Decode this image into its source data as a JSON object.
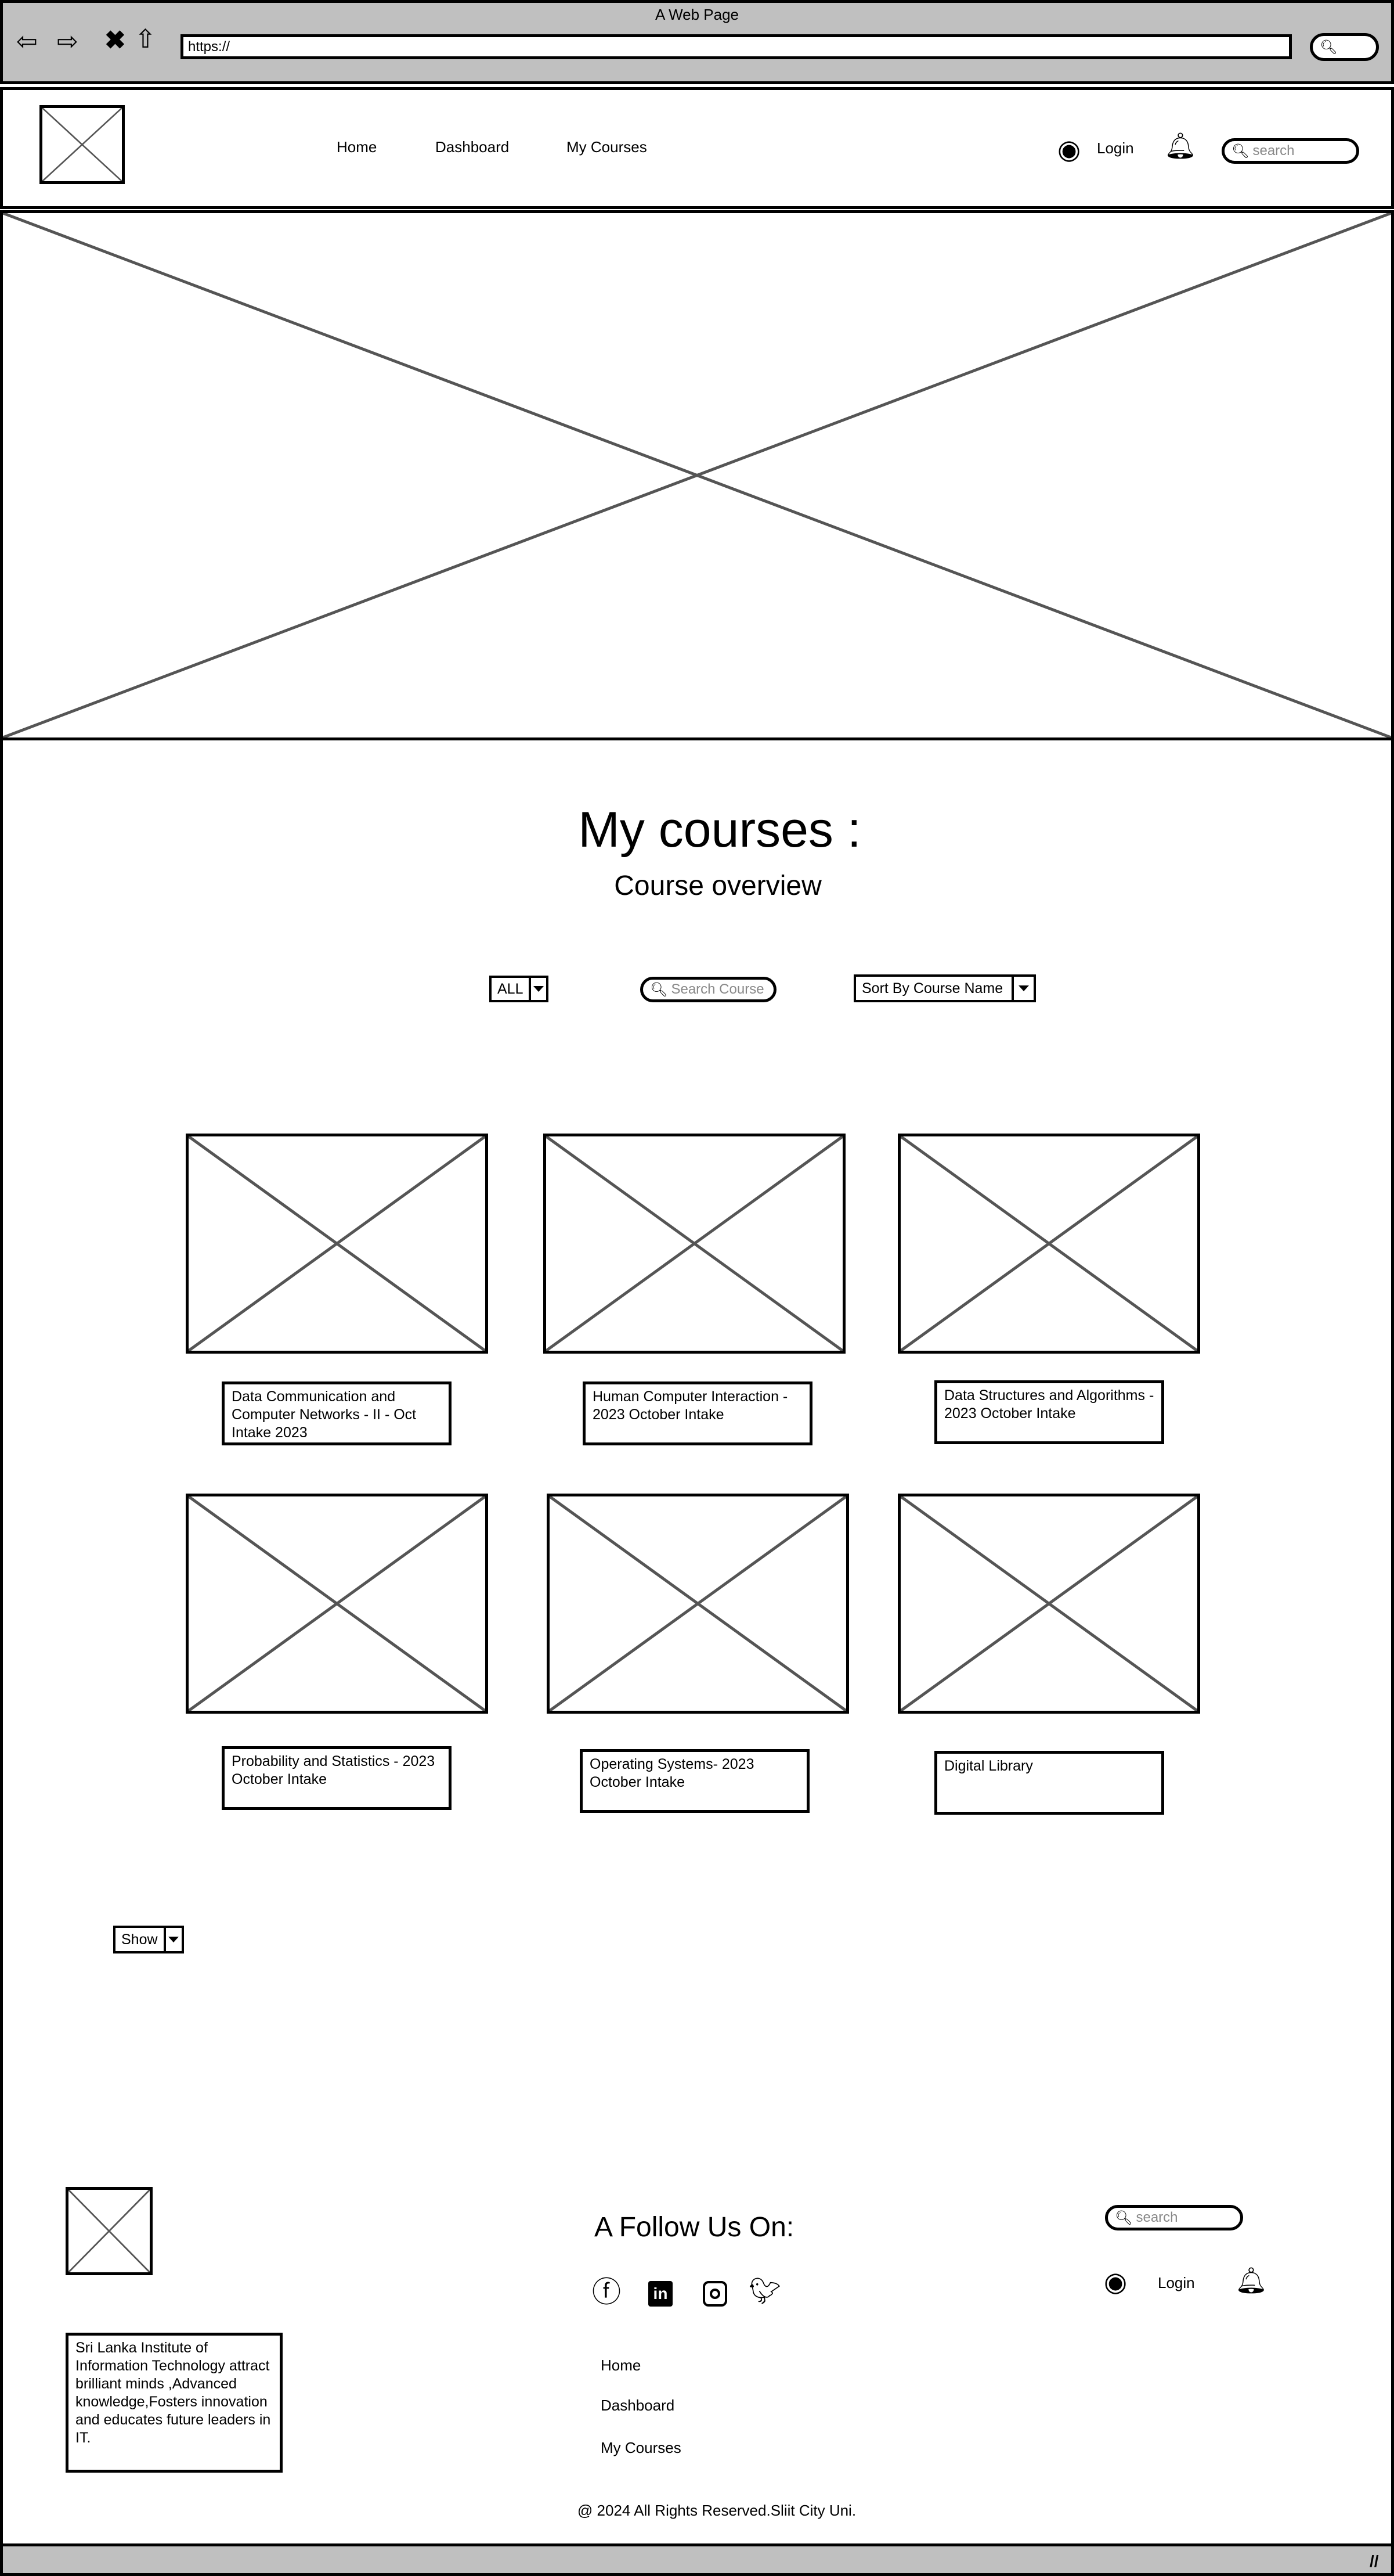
{
  "browser": {
    "title": "A Web Page",
    "url": "https://"
  },
  "header": {
    "nav": [
      "Home",
      "Dashboard",
      "My Courses"
    ],
    "login": "Login",
    "search_placeholder": "search"
  },
  "main": {
    "title": "My courses :",
    "subtitle": "Course overview",
    "filters": {
      "category": "ALL",
      "search_placeholder": "Search Course",
      "sort": "Sort By Course Name"
    },
    "courses": [
      "Data Communication and Computer Networks - II - Oct Intake 2023",
      "Human Computer Interaction - 2023 October Intake",
      "Data Structures and Algorithms - 2023 October Intake",
      "Probability and Statistics - 2023 October Intake",
      "Operating Systems- 2023 October Intake",
      "Digital Library"
    ],
    "show": "Show"
  },
  "footer": {
    "about": "Sri Lanka Institute of Information Technology attract brilliant minds ,Advanced knowledge,Fosters innovation and educates future leaders in IT.",
    "follow_title": "A Follow Us On:",
    "social": [
      "facebook",
      "linkedin",
      "instagram",
      "twitter"
    ],
    "nav": [
      "Home",
      "Dashboard",
      "My Courses"
    ],
    "search_placeholder": "search",
    "login": "Login",
    "copyright": "@ 2024 All Rights Reserved.Sliit City Uni."
  }
}
